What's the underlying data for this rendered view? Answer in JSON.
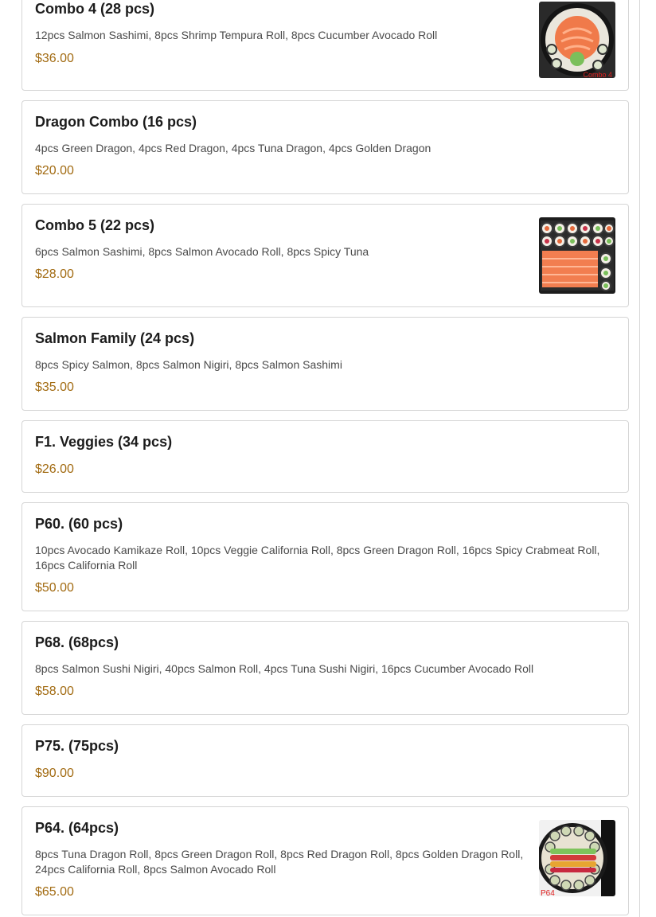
{
  "menu_items": [
    {
      "name": "Combo 4 (28 pcs)",
      "description": "12pcs Salmon Sashimi, 8pcs Shrimp Tempura Roll, 8pcs Cucumber Avocado Roll",
      "price": "$36.00",
      "image_caption": "Combo 4"
    },
    {
      "name": "Dragon Combo (16 pcs)",
      "description": "4pcs Green Dragon, 4pcs Red Dragon, 4pcs Tuna Dragon, 4pcs Golden Dragon",
      "price": "$20.00"
    },
    {
      "name": "Combo 5 (22 pcs)",
      "description": "6pcs Salmon Sashimi, 8pcs Salmon Avocado Roll, 8pcs Spicy Tuna",
      "price": "$28.00"
    },
    {
      "name": "Salmon Family (24 pcs)",
      "description": "8pcs Spicy Salmon, 8pcs Salmon Nigiri, 8pcs Salmon Sashimi",
      "price": "$35.00"
    },
    {
      "name": "F1. Veggies (34 pcs)",
      "price": "$26.00"
    },
    {
      "name": "P60. (60 pcs)",
      "description": "10pcs Avocado Kamikaze Roll, 10pcs Veggie California Roll, 8pcs Green Dragon Roll, 16pcs Spicy Crabmeat Roll, 16pcs California Roll",
      "price": "$50.00"
    },
    {
      "name": "P68. (68pcs)",
      "description": "8pcs Salmon Sushi Nigiri, 40pcs Salmon Roll, 4pcs Tuna Sushi Nigiri, 16pcs Cucumber Avocado Roll",
      "price": "$58.00"
    },
    {
      "name": "P75. (75pcs)",
      "price": "$90.00"
    },
    {
      "name": "P64. (64pcs)",
      "description": "8pcs Tuna Dragon Roll, 8pcs Green Dragon Roll, 8pcs Red Dragon Roll, 8pcs Golden Dragon Roll, 24pcs California Roll, 8pcs Salmon Avocado Roll",
      "price": "$65.00",
      "image_caption": "P64"
    }
  ],
  "colors": {
    "price": "#a26b12",
    "border": "#d5d5d5"
  }
}
